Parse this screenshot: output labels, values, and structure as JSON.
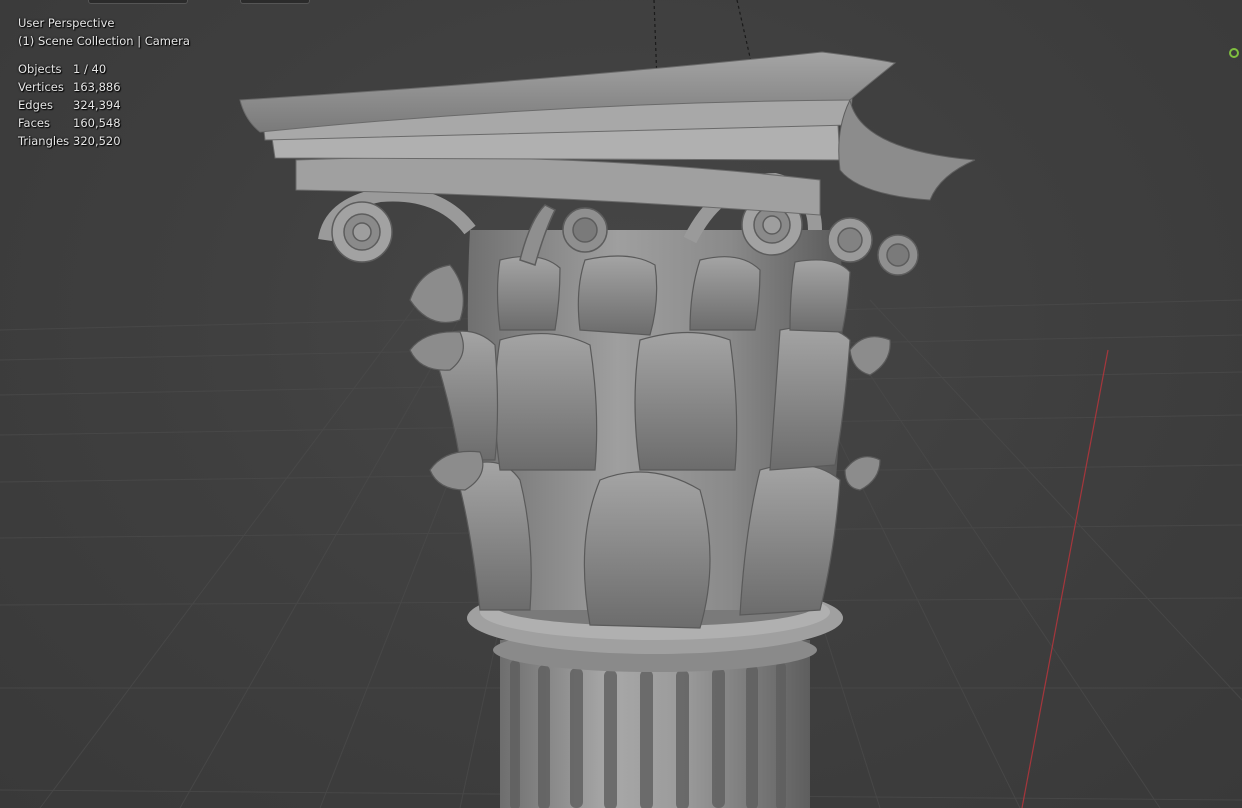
{
  "viewport": {
    "view_name": "User Perspective",
    "scene_path": "(1) Scene Collection | Camera"
  },
  "stats": [
    {
      "label": "Objects",
      "value": "1 / 40"
    },
    {
      "label": "Vertices",
      "value": "163,886"
    },
    {
      "label": "Edges",
      "value": "324,394"
    },
    {
      "label": "Faces",
      "value": "160,548"
    },
    {
      "label": "Triangles",
      "value": "320,520"
    }
  ],
  "colors": {
    "background": "#3d3d3d",
    "grid": "#4a4a4a",
    "x_axis": "#c8343c",
    "mesh": "#8e8e8e",
    "gizmo": "#7fbf3f"
  },
  "icons": {
    "gizmo": "camera-gizmo-icon"
  }
}
